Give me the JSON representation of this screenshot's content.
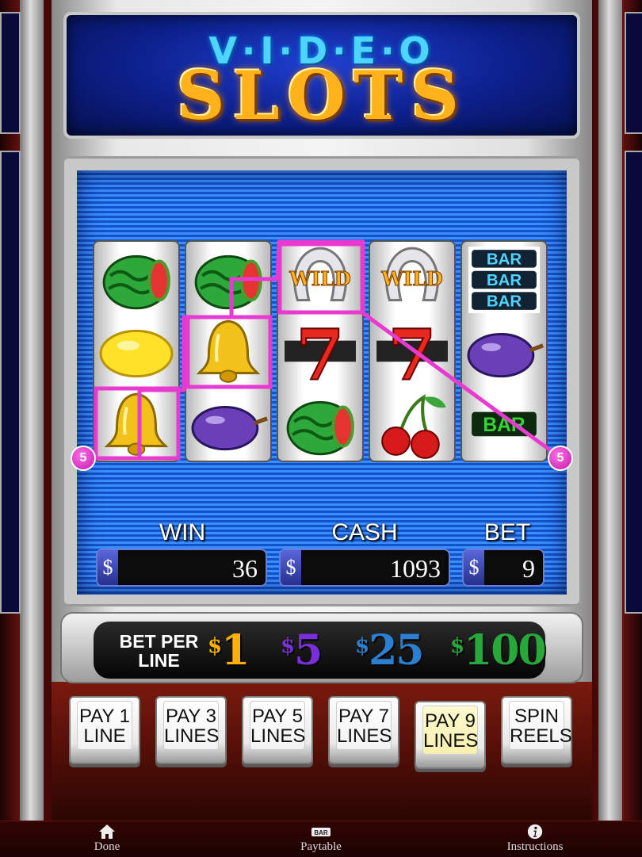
{
  "header": {
    "title_top": "V·I·D·E·O",
    "title_main": "SLOTS"
  },
  "reels": [
    [
      "watermelon",
      "lemon",
      "bell"
    ],
    [
      "watermelon",
      "bell",
      "plum"
    ],
    [
      "wild",
      "seven",
      "watermelon"
    ],
    [
      "wild",
      "seven",
      "cherries"
    ],
    [
      "triple-bar",
      "plum",
      "single-bar"
    ]
  ],
  "symbol_text": {
    "wild": "WILD",
    "bar": "BAR"
  },
  "payline": {
    "number": "5",
    "color": "#e83ad0"
  },
  "meters": {
    "win": {
      "label": "WIN",
      "currency": "$",
      "value": "36"
    },
    "cash": {
      "label": "CASH",
      "currency": "$",
      "value": "1093"
    },
    "bet": {
      "label": "BET",
      "currency": "$",
      "value": "9"
    }
  },
  "bet_per_line": {
    "label_line1": "BET PER",
    "label_line2": "LINE",
    "denominations": [
      {
        "symbol": "$",
        "amount": "1",
        "color": "#ffb300"
      },
      {
        "symbol": "$",
        "amount": "5",
        "color": "#7a2fd8"
      },
      {
        "symbol": "$",
        "amount": "25",
        "color": "#2a7fd0"
      },
      {
        "symbol": "$",
        "amount": "100",
        "color": "#27a83a"
      }
    ]
  },
  "buttons": [
    {
      "line1": "PAY 1",
      "line2": "LINE",
      "active": false
    },
    {
      "line1": "PAY 3",
      "line2": "LINES",
      "active": false
    },
    {
      "line1": "PAY 5",
      "line2": "LINES",
      "active": false
    },
    {
      "line1": "PAY 7",
      "line2": "LINES",
      "active": false
    },
    {
      "line1": "PAY 9",
      "line2": "LINES",
      "active": true
    },
    {
      "line1": "SPIN",
      "line2": "REELS",
      "active": false
    }
  ],
  "tabbar": {
    "done": "Done",
    "paytable": "Paytable",
    "paytable_icon_text": "BAR",
    "instructions": "Instructions"
  }
}
